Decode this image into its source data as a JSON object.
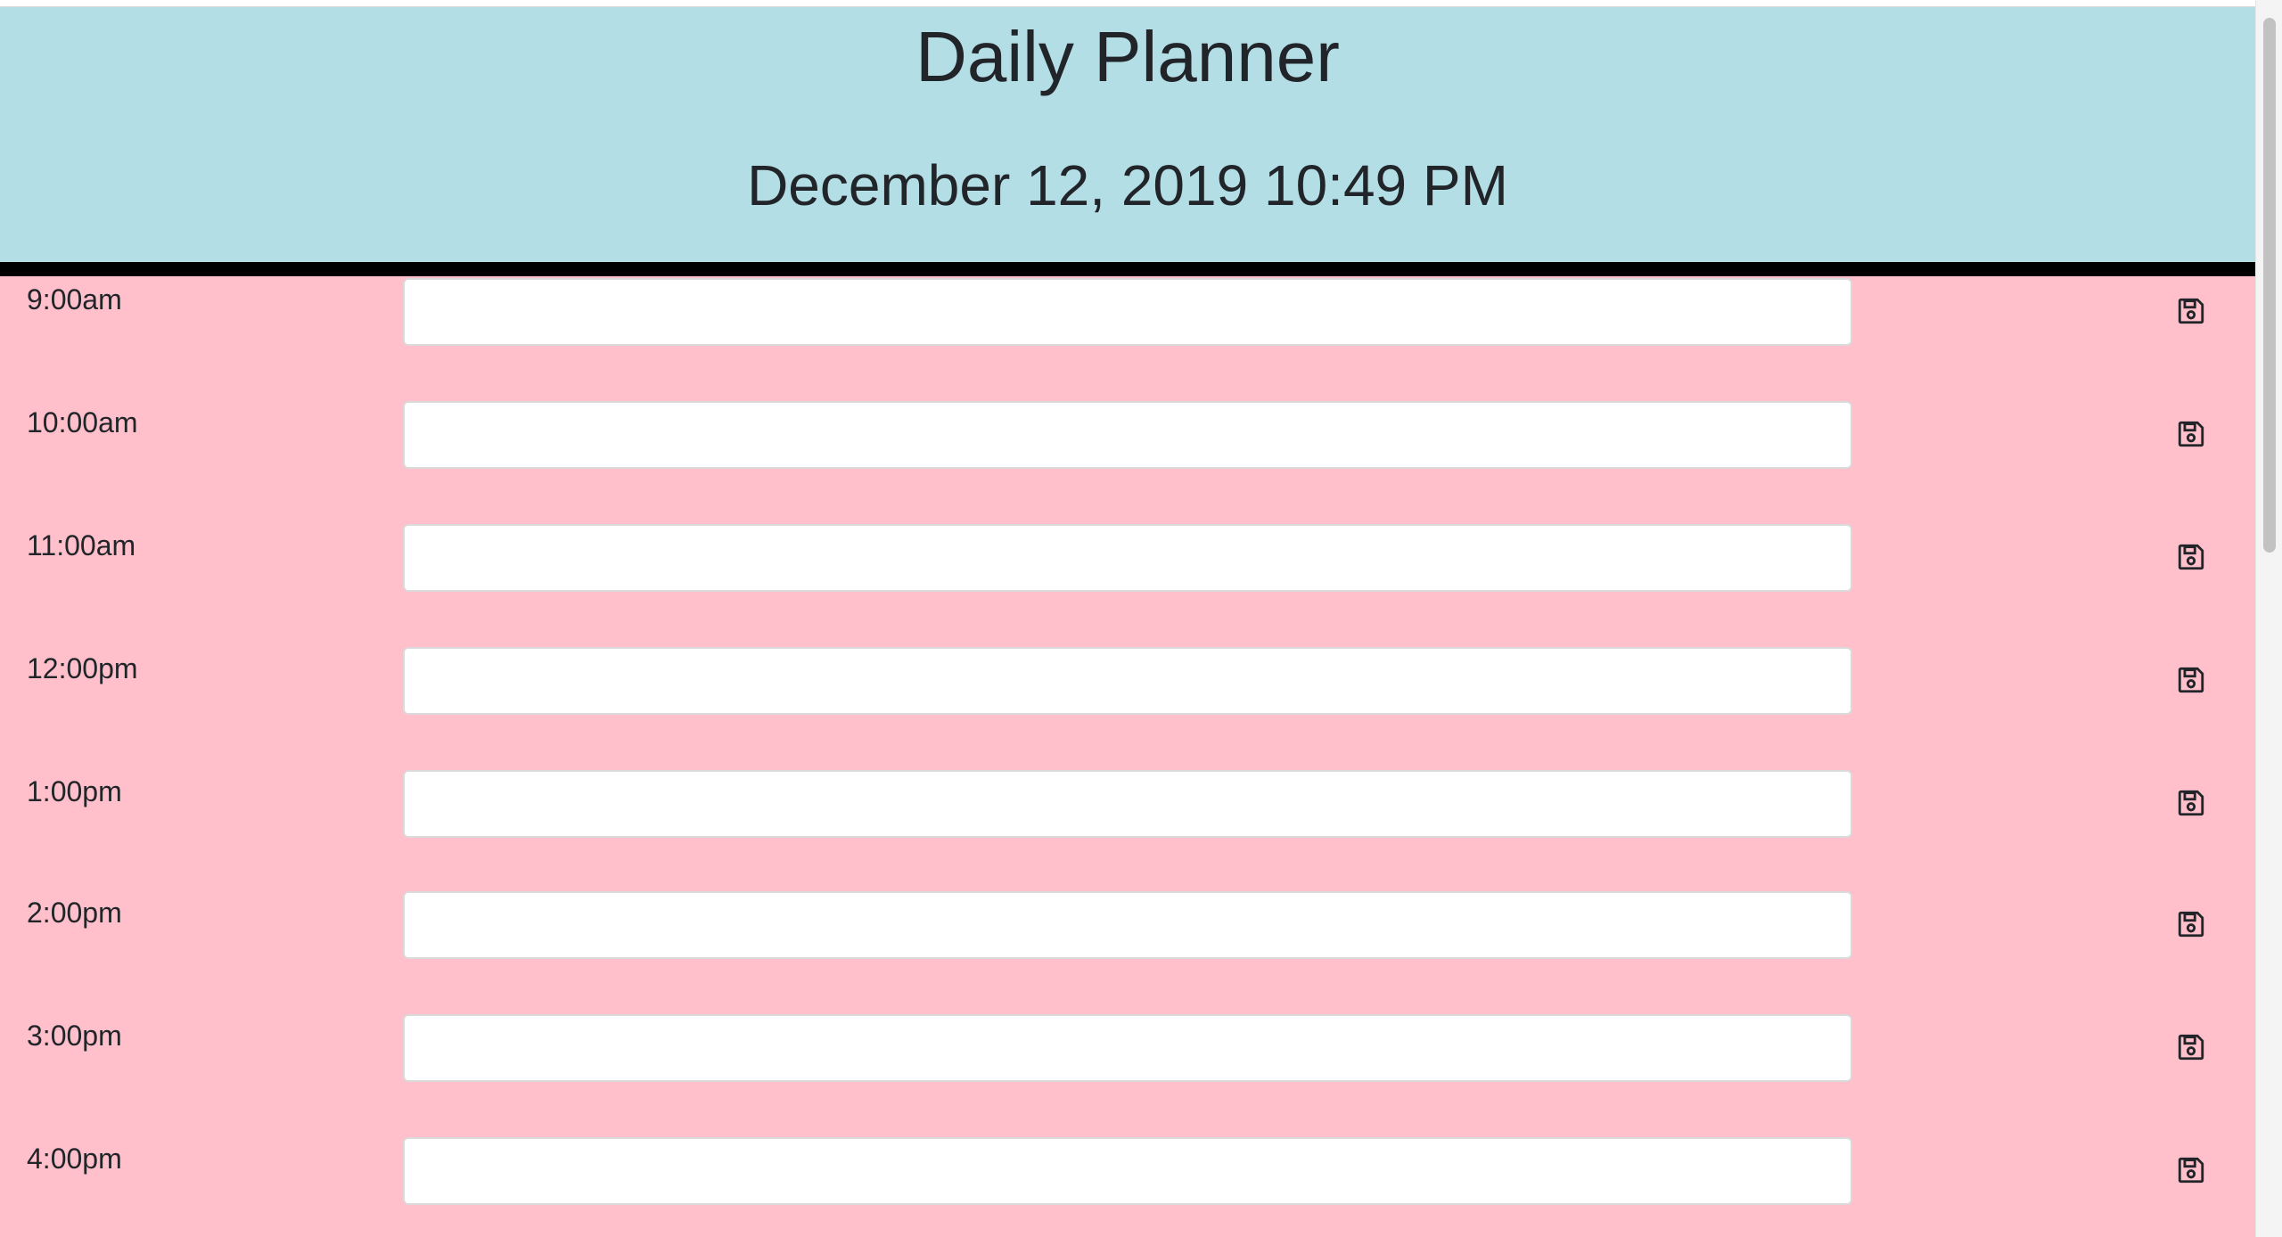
{
  "header": {
    "title": "Daily Planner",
    "datetime": "December 12, 2019 10:49 PM"
  },
  "colors": {
    "header_bg": "#b3dee5",
    "schedule_bg": "#ffc0cb",
    "divider": "#000000"
  },
  "schedule": {
    "rows": [
      {
        "hour": "9:00am",
        "task": ""
      },
      {
        "hour": "10:00am",
        "task": ""
      },
      {
        "hour": "11:00am",
        "task": ""
      },
      {
        "hour": "12:00pm",
        "task": ""
      },
      {
        "hour": "1:00pm",
        "task": ""
      },
      {
        "hour": "2:00pm",
        "task": ""
      },
      {
        "hour": "3:00pm",
        "task": ""
      },
      {
        "hour": "4:00pm",
        "task": ""
      }
    ],
    "save_icon": "floppy-disk-icon"
  }
}
